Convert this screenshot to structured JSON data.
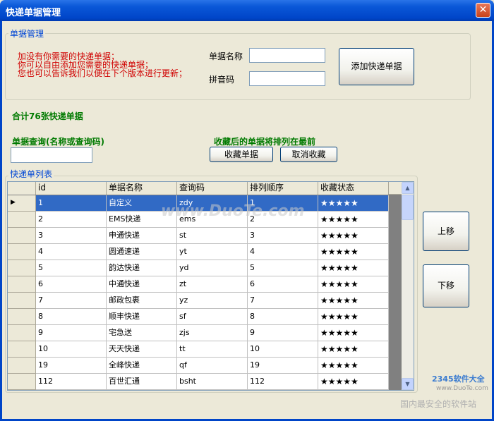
{
  "window": {
    "title": "快递单据管理",
    "close": "✕"
  },
  "manage_group": {
    "label": "单据管理",
    "hints": [
      "加没有你需要的快递单据；",
      "你可以自由添加您需要的快递单据；",
      "您也可以告诉我们以便在下个版本进行更新；"
    ],
    "name_label": "单据名称",
    "pinyin_label": "拼音码",
    "name_value": "",
    "pinyin_value": "",
    "add_button": "添加快递单据"
  },
  "total_text": "合计76张快递单据",
  "query": {
    "label": "单据查询(名称或查询码)",
    "value": ""
  },
  "favorite": {
    "note": "收藏后的单据将排列在最前",
    "fav_button": "收藏单据",
    "unfav_button": "取消收藏"
  },
  "list_group": {
    "label": "快递单列表"
  },
  "grid": {
    "columns": [
      "id",
      "单据名称",
      "查询码",
      "排列顺序",
      "收藏状态"
    ],
    "rows": [
      {
        "id": "1",
        "name": "自定义",
        "code": "zdy",
        "order": "1",
        "fav": "★★★★★",
        "selected": true
      },
      {
        "id": "2",
        "name": "EMS快递",
        "code": "ems",
        "order": "2",
        "fav": "★★★★★"
      },
      {
        "id": "3",
        "name": "申通快递",
        "code": "st",
        "order": "3",
        "fav": "★★★★★"
      },
      {
        "id": "4",
        "name": "圆通速递",
        "code": "yt",
        "order": "4",
        "fav": "★★★★★"
      },
      {
        "id": "5",
        "name": "韵达快递",
        "code": "yd",
        "order": "5",
        "fav": "★★★★★"
      },
      {
        "id": "6",
        "name": "中通快递",
        "code": "zt",
        "order": "6",
        "fav": "★★★★★"
      },
      {
        "id": "7",
        "name": "邮政包裹",
        "code": "yz",
        "order": "7",
        "fav": "★★★★★"
      },
      {
        "id": "8",
        "name": "顺丰快递",
        "code": "sf",
        "order": "8",
        "fav": "★★★★★"
      },
      {
        "id": "9",
        "name": "宅急送",
        "code": "zjs",
        "order": "9",
        "fav": "★★★★★"
      },
      {
        "id": "10",
        "name": "天天快递",
        "code": "tt",
        "order": "10",
        "fav": "★★★★★"
      },
      {
        "id": "19",
        "name": "全峰快递",
        "code": "qf",
        "order": "19",
        "fav": "★★★★★"
      },
      {
        "id": "112",
        "name": "百世汇通",
        "code": "bsht",
        "order": "112",
        "fav": "★★★★★"
      }
    ],
    "current_marker": "▶"
  },
  "side": {
    "up": "上移",
    "down": "下移"
  },
  "watermarks": {
    "center": "www.DuoTe.com",
    "corner1": "2345软件大全",
    "corner2": "www.DuoTe.com",
    "corner3": "国内最安全的软件站"
  },
  "colors": {
    "title_bar": "#0045c8",
    "selected_row": "#316ac5",
    "hint": "#d00000",
    "green": "#007a00"
  }
}
